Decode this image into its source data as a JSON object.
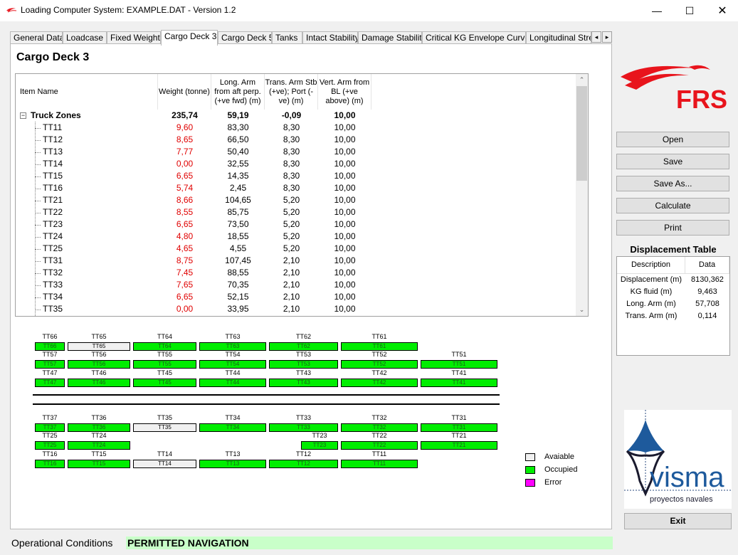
{
  "window": {
    "title": "Loading Computer System: EXAMPLE.DAT - Version 1.2",
    "min_glyph": "—",
    "max_glyph": "☐",
    "close_glyph": "✕"
  },
  "tabs": [
    {
      "label": "General Data"
    },
    {
      "label": "Loadcase"
    },
    {
      "label": "Fixed Weights"
    },
    {
      "label": "Cargo Deck 3",
      "active": true
    },
    {
      "label": "Cargo Deck 5"
    },
    {
      "label": "Tanks"
    },
    {
      "label": "Intact Stability"
    },
    {
      "label": "Damage Stability"
    },
    {
      "label": "Critical KG Envelope Curves"
    },
    {
      "label": "Longitudinal Strer"
    }
  ],
  "tab_scroll": {
    "left": "◂",
    "right": "▸"
  },
  "page_title": "Cargo Deck 3",
  "columns": {
    "name": "Item Name",
    "weight": "Weight (tonne)",
    "long": "Long. Arm from aft perp. (+ve fwd) (m)",
    "trans": "Trans. Arm Stb (+ve); Port (-ve) (m)",
    "vert": "Vert. Arm from BL (+ve above) (m)"
  },
  "group": {
    "expander": "−",
    "name": "Truck Zones",
    "weight": "235,74",
    "long": "59,19",
    "trans": "-0,09",
    "vert": "10,00"
  },
  "rows": [
    {
      "name": "TT11",
      "weight": "9,60",
      "long": "83,30",
      "trans": "8,30",
      "vert": "10,00"
    },
    {
      "name": "TT12",
      "weight": "8,65",
      "long": "66,50",
      "trans": "8,30",
      "vert": "10,00"
    },
    {
      "name": "TT13",
      "weight": "7,77",
      "long": "50,40",
      "trans": "8,30",
      "vert": "10,00"
    },
    {
      "name": "TT14",
      "weight": "0,00",
      "long": "32,55",
      "trans": "8,30",
      "vert": "10,00"
    },
    {
      "name": "TT15",
      "weight": "6,65",
      "long": "14,35",
      "trans": "8,30",
      "vert": "10,00"
    },
    {
      "name": "TT16",
      "weight": "5,74",
      "long": "2,45",
      "trans": "8,30",
      "vert": "10,00"
    },
    {
      "name": "TT21",
      "weight": "8,66",
      "long": "104,65",
      "trans": "5,20",
      "vert": "10,00"
    },
    {
      "name": "TT22",
      "weight": "8,55",
      "long": "85,75",
      "trans": "5,20",
      "vert": "10,00"
    },
    {
      "name": "TT23",
      "weight": "6,65",
      "long": "73,50",
      "trans": "5,20",
      "vert": "10,00"
    },
    {
      "name": "TT24",
      "weight": "4,80",
      "long": "18,55",
      "trans": "5,20",
      "vert": "10,00"
    },
    {
      "name": "TT25",
      "weight": "4,65",
      "long": "4,55",
      "trans": "5,20",
      "vert": "10,00"
    },
    {
      "name": "TT31",
      "weight": "8,75",
      "long": "107,45",
      "trans": "2,10",
      "vert": "10,00"
    },
    {
      "name": "TT32",
      "weight": "7,45",
      "long": "88,55",
      "trans": "2,10",
      "vert": "10,00"
    },
    {
      "name": "TT33",
      "weight": "7,65",
      "long": "70,35",
      "trans": "2,10",
      "vert": "10,00"
    },
    {
      "name": "TT34",
      "weight": "6,65",
      "long": "52,15",
      "trans": "2,10",
      "vert": "10,00"
    },
    {
      "name": "TT35",
      "weight": "0,00",
      "long": "33,95",
      "trans": "2,10",
      "vert": "10,00"
    }
  ],
  "scroll": {
    "up": "⌃",
    "down": "⌄"
  },
  "deck_zones": [
    {
      "id": "TT66",
      "status": "occupied"
    },
    {
      "id": "TT65",
      "status": "available"
    },
    {
      "id": "TT64",
      "status": "occupied"
    },
    {
      "id": "TT63",
      "status": "occupied"
    },
    {
      "id": "TT62",
      "status": "occupied"
    },
    {
      "id": "TT61",
      "status": "occupied"
    },
    {
      "id": "TT57",
      "status": "occupied"
    },
    {
      "id": "TT56",
      "status": "occupied"
    },
    {
      "id": "TT55",
      "status": "occupied"
    },
    {
      "id": "TT54",
      "status": "occupied"
    },
    {
      "id": "TT53",
      "status": "occupied"
    },
    {
      "id": "TT52",
      "status": "occupied"
    },
    {
      "id": "TT51",
      "status": "occupied"
    },
    {
      "id": "TT47",
      "status": "occupied"
    },
    {
      "id": "TT46",
      "status": "occupied"
    },
    {
      "id": "TT45",
      "status": "occupied"
    },
    {
      "id": "TT44",
      "status": "occupied"
    },
    {
      "id": "TT43",
      "status": "occupied"
    },
    {
      "id": "TT42",
      "status": "occupied"
    },
    {
      "id": "TT41",
      "status": "occupied"
    },
    {
      "id": "TT37",
      "status": "occupied"
    },
    {
      "id": "TT36",
      "status": "occupied"
    },
    {
      "id": "TT35",
      "status": "available"
    },
    {
      "id": "TT34",
      "status": "occupied"
    },
    {
      "id": "TT33",
      "status": "occupied"
    },
    {
      "id": "TT32",
      "status": "occupied"
    },
    {
      "id": "TT31",
      "status": "occupied"
    },
    {
      "id": "TT25",
      "status": "occupied"
    },
    {
      "id": "TT24",
      "status": "occupied"
    },
    {
      "id": "TT23",
      "status": "occupied"
    },
    {
      "id": "TT22",
      "status": "occupied"
    },
    {
      "id": "TT21",
      "status": "occupied"
    },
    {
      "id": "TT16",
      "status": "occupied"
    },
    {
      "id": "TT15",
      "status": "occupied"
    },
    {
      "id": "TT14",
      "status": "available"
    },
    {
      "id": "TT13",
      "status": "occupied"
    },
    {
      "id": "TT12",
      "status": "occupied"
    },
    {
      "id": "TT11",
      "status": "occupied"
    }
  ],
  "legend": {
    "available": "Avaiable",
    "occupied": "Occupied",
    "error": "Error",
    "colors": {
      "available": "#f0f0f0",
      "occupied": "#00ee00",
      "error": "#ff00ff"
    }
  },
  "brand": {
    "frs": "FRS",
    "frs_color": "#e8141c",
    "visma": "visma",
    "visma_sub": "proyectos navales"
  },
  "buttons": {
    "open": "Open",
    "save": "Save",
    "save_as": "Save As...",
    "calculate": "Calculate",
    "print": "Print",
    "exit": "Exit"
  },
  "displacement": {
    "title": "Displacement Table",
    "col_desc": "Description",
    "col_data": "Data",
    "rows": [
      {
        "desc": "Displacement (m)",
        "value": "8130,362"
      },
      {
        "desc": "KG fluid (m)",
        "value": "9,463"
      },
      {
        "desc": "Long. Arm (m)",
        "value": "57,708"
      },
      {
        "desc": "Trans. Arm (m)",
        "value": "0,114"
      }
    ]
  },
  "operational": {
    "label": "Operational Conditions",
    "value": "PERMITTED NAVIGATION",
    "color": "#c9ffc9"
  }
}
